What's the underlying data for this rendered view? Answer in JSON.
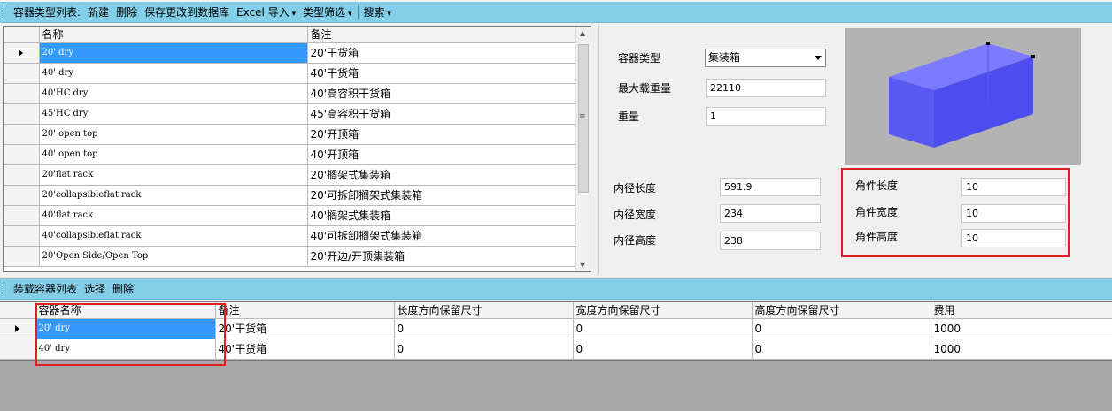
{
  "toolbar_top": {
    "title": "容器类型列表:",
    "items": [
      "新建",
      "删除",
      "保存更改到数据库",
      "Excel 导入",
      "类型筛选",
      "搜索"
    ]
  },
  "type_grid": {
    "columns": [
      "名称",
      "备注"
    ],
    "rows": [
      {
        "name": "20' dry",
        "note": "20'干货箱"
      },
      {
        "name": "40'  dry",
        "note": "40'干货箱"
      },
      {
        "name": "40'HC dry",
        "note": "40'高容积干货箱"
      },
      {
        "name": "45'HC dry",
        "note": "45'高容积干货箱"
      },
      {
        "name": "20'  open top",
        "note": "20'开顶箱"
      },
      {
        "name": "40'  open top",
        "note": "40'开顶箱"
      },
      {
        "name": "20'flat rack",
        "note": "20'搁架式集装箱"
      },
      {
        "name": "20'collapsibleflat rack",
        "note": "20'可拆卸搁架式集装箱"
      },
      {
        "name": "40'flat rack",
        "note": "40'搁架式集装箱"
      },
      {
        "name": "40'collapsibleflat rack",
        "note": "40'可拆卸搁架式集装箱"
      },
      {
        "name": "20'Open Side/Open Top",
        "note": "20'开边/开顶集装箱"
      }
    ]
  },
  "detail": {
    "container_type_label": "容器类型",
    "container_type_value": "集装箱",
    "max_load_label": "最大载重量",
    "max_load_value": "22110",
    "weight_label": "重量",
    "weight_value": "1",
    "inner_length_label": "内径长度",
    "inner_length_value": "591.9",
    "inner_width_label": "内径宽度",
    "inner_width_value": "234",
    "inner_height_label": "内径高度",
    "inner_height_value": "238",
    "corner_length_label": "角件长度",
    "corner_length_value": "10",
    "corner_width_label": "角件宽度",
    "corner_width_value": "10",
    "corner_height_label": "角件高度",
    "corner_height_value": "10"
  },
  "colors": {
    "box_front": "#5b5bf5",
    "box_side": "#4a4ae8",
    "box_top": "#7b7bff",
    "highlight": "#e02020"
  },
  "toolbar_bottom": {
    "title": "装载容器列表",
    "items": [
      "选择",
      "删除"
    ]
  },
  "load_grid": {
    "columns": [
      "容器名称",
      "备注",
      "长度方向保留尺寸",
      "宽度方向保留尺寸",
      "高度方向保留尺寸",
      "费用"
    ],
    "rows": [
      {
        "name": "20' dry",
        "note": "20'干货箱",
        "len": "0",
        "wid": "0",
        "hei": "0",
        "cost": "1000"
      },
      {
        "name": "40'  dry",
        "note": "40'干货箱",
        "len": "0",
        "wid": "0",
        "hei": "0",
        "cost": "1000"
      }
    ]
  }
}
